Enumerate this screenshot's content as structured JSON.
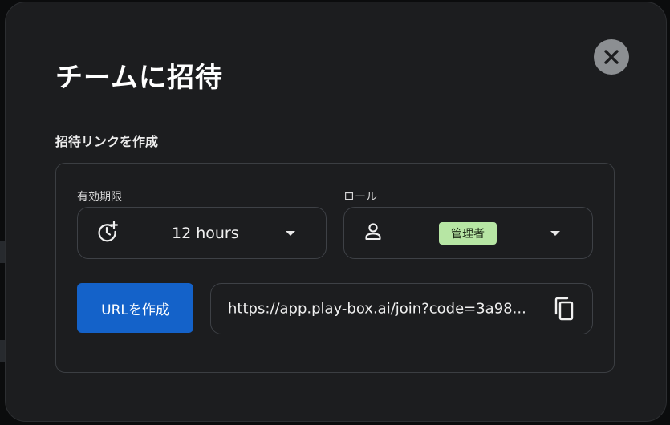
{
  "modal": {
    "title": "チームに招待",
    "section_label": "招待リンクを作成",
    "close_icon": "close-icon"
  },
  "expiry": {
    "label": "有効期限",
    "value": "12 hours",
    "icon": "clock-plus-icon"
  },
  "role": {
    "label": "ロール",
    "value": "管理者",
    "icon": "person-icon"
  },
  "actions": {
    "create_label": "URLを作成"
  },
  "invite": {
    "url": "https://app.play-box.ai/join?code=3a98...",
    "copy_icon": "copy-icon"
  },
  "colors": {
    "accent": "#1462c9",
    "badge_bg": "#b7e6a4",
    "modal_bg": "#1c1d1f"
  }
}
